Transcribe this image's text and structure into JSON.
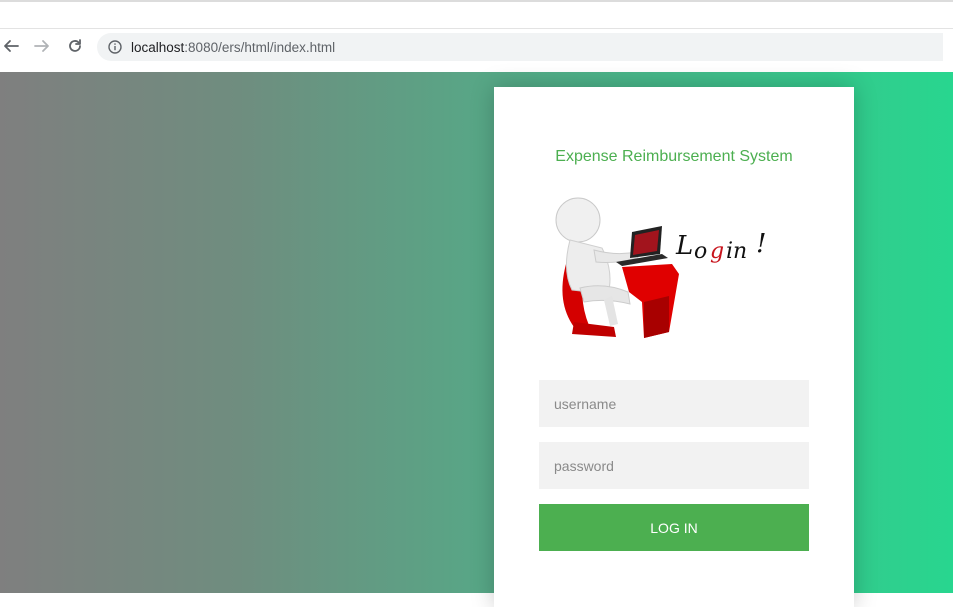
{
  "browser": {
    "url_host": "localhost",
    "url_rest": ":8080/ers/html/index.html",
    "icons": {
      "back": "back-arrow-icon",
      "forward": "forward-arrow-icon",
      "reload": "reload-icon",
      "info": "info-icon"
    }
  },
  "login": {
    "title": "Expense Reimbursement System",
    "illustration_text": "Login !",
    "username_placeholder": "username",
    "password_placeholder": "password",
    "submit_label": "LOG IN"
  },
  "colors": {
    "accent": "#4caf50",
    "gradient_start": "#7f7f7f",
    "gradient_end": "#28d68f",
    "field_background": "#f2f2f2"
  }
}
